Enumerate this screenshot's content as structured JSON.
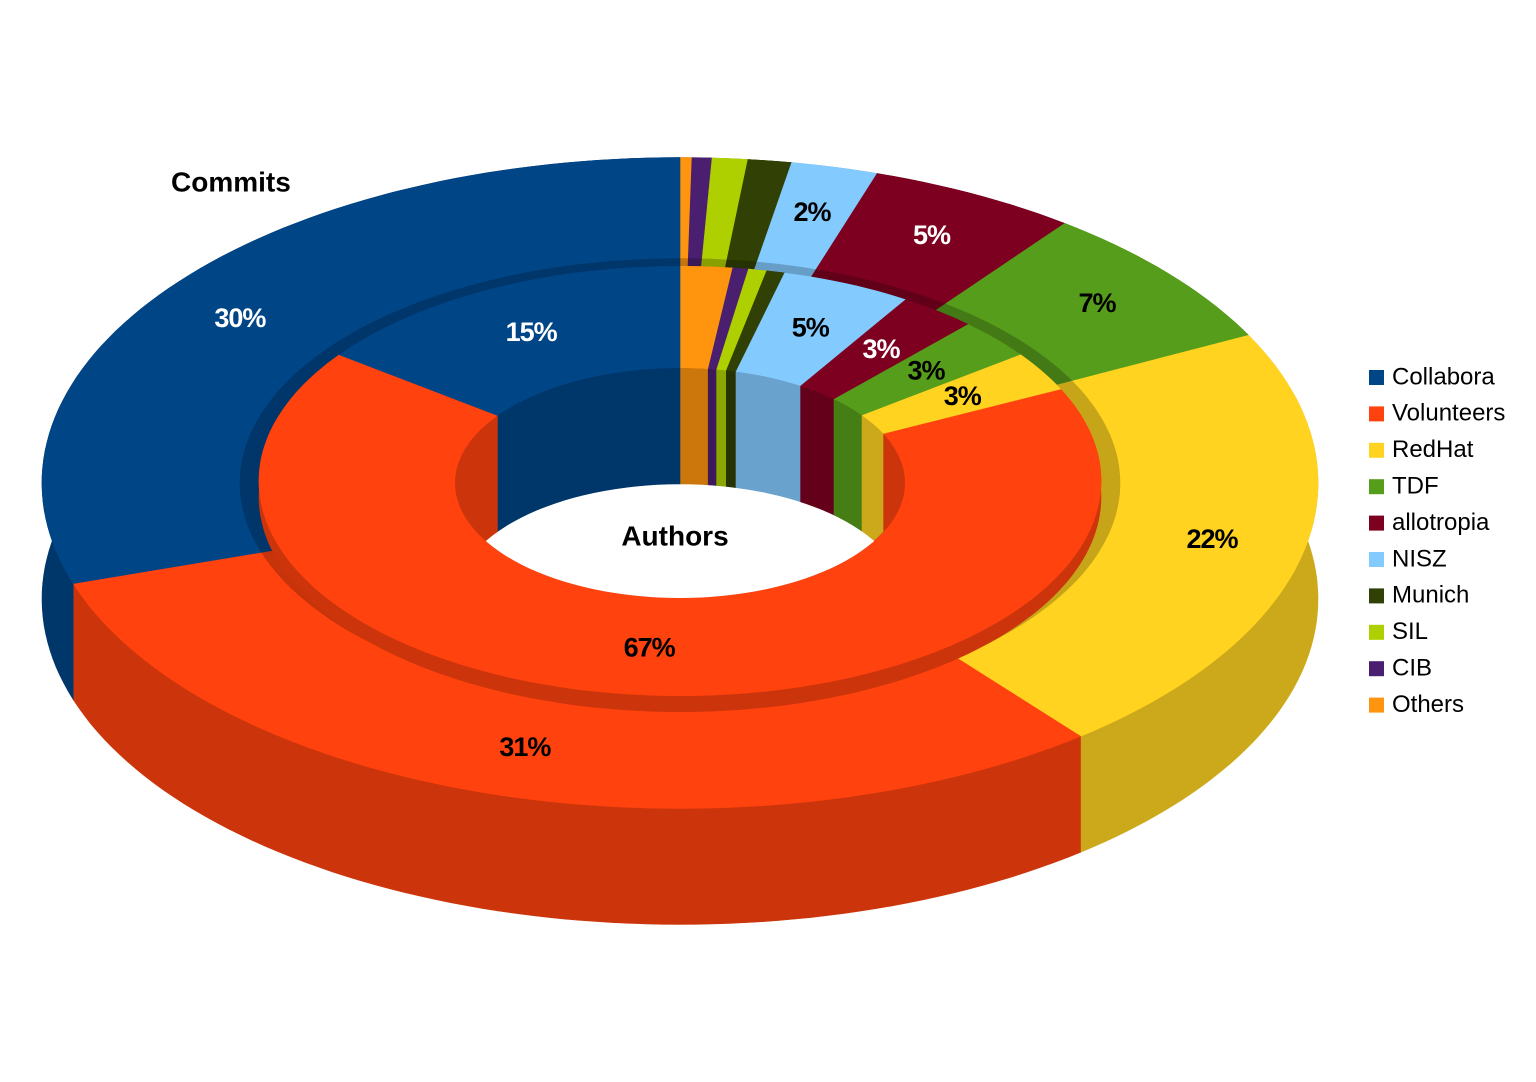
{
  "chart_data": {
    "type": "pie",
    "subtype": "3d-donut",
    "legend_position": "right",
    "categories": [
      "Collabora",
      "Volunteers",
      "RedHat",
      "TDF",
      "allotropia",
      "NISZ",
      "Munich",
      "SIL",
      "CIB",
      "Others"
    ],
    "colors": {
      "Collabora": "#004586",
      "Volunteers": "#ff420e",
      "RedHat": "#ffd320",
      "TDF": "#579d1c",
      "allotropia": "#7e0021",
      "NISZ": "#83caff",
      "Munich": "#314004",
      "SIL": "#aecf00",
      "CIB": "#4b1f6f",
      "Others": "#ff950e"
    },
    "series": [
      {
        "name": "Commits",
        "ring": "outer",
        "values": [
          30.0,
          30.8,
          21.7,
          7.2,
          5.3,
          2.2,
          1.1,
          0.9,
          0.5,
          0.3
        ],
        "labels": [
          "30%",
          "31%",
          "22%",
          "7%",
          "5%",
          "2%",
          "",
          "",
          "",
          ""
        ]
      },
      {
        "name": "Authors",
        "ring": "inner",
        "values": [
          15.0,
          67.0,
          3.0,
          3.0,
          3.0,
          5.0,
          0.7,
          0.7,
          0.6,
          2.0
        ],
        "labels": [
          "15%",
          "67%",
          "3%",
          "3%",
          "3%",
          "5%",
          "",
          "",
          "",
          ""
        ]
      }
    ]
  },
  "titles": {
    "commits": "Commits",
    "authors": "Authors"
  },
  "legend": [
    {
      "label": "Collabora",
      "color": "#004586"
    },
    {
      "label": "Volunteers",
      "color": "#ff420e"
    },
    {
      "label": "RedHat",
      "color": "#ffd320"
    },
    {
      "label": "TDF",
      "color": "#579d1c"
    },
    {
      "label": "allotropia",
      "color": "#7e0021"
    },
    {
      "label": "NISZ",
      "color": "#83caff"
    },
    {
      "label": "Munich",
      "color": "#314004"
    },
    {
      "label": "SIL",
      "color": "#aecf00"
    },
    {
      "label": "CIB",
      "color": "#4b1f6f"
    },
    {
      "label": "Others",
      "color": "#ff950e"
    }
  ]
}
